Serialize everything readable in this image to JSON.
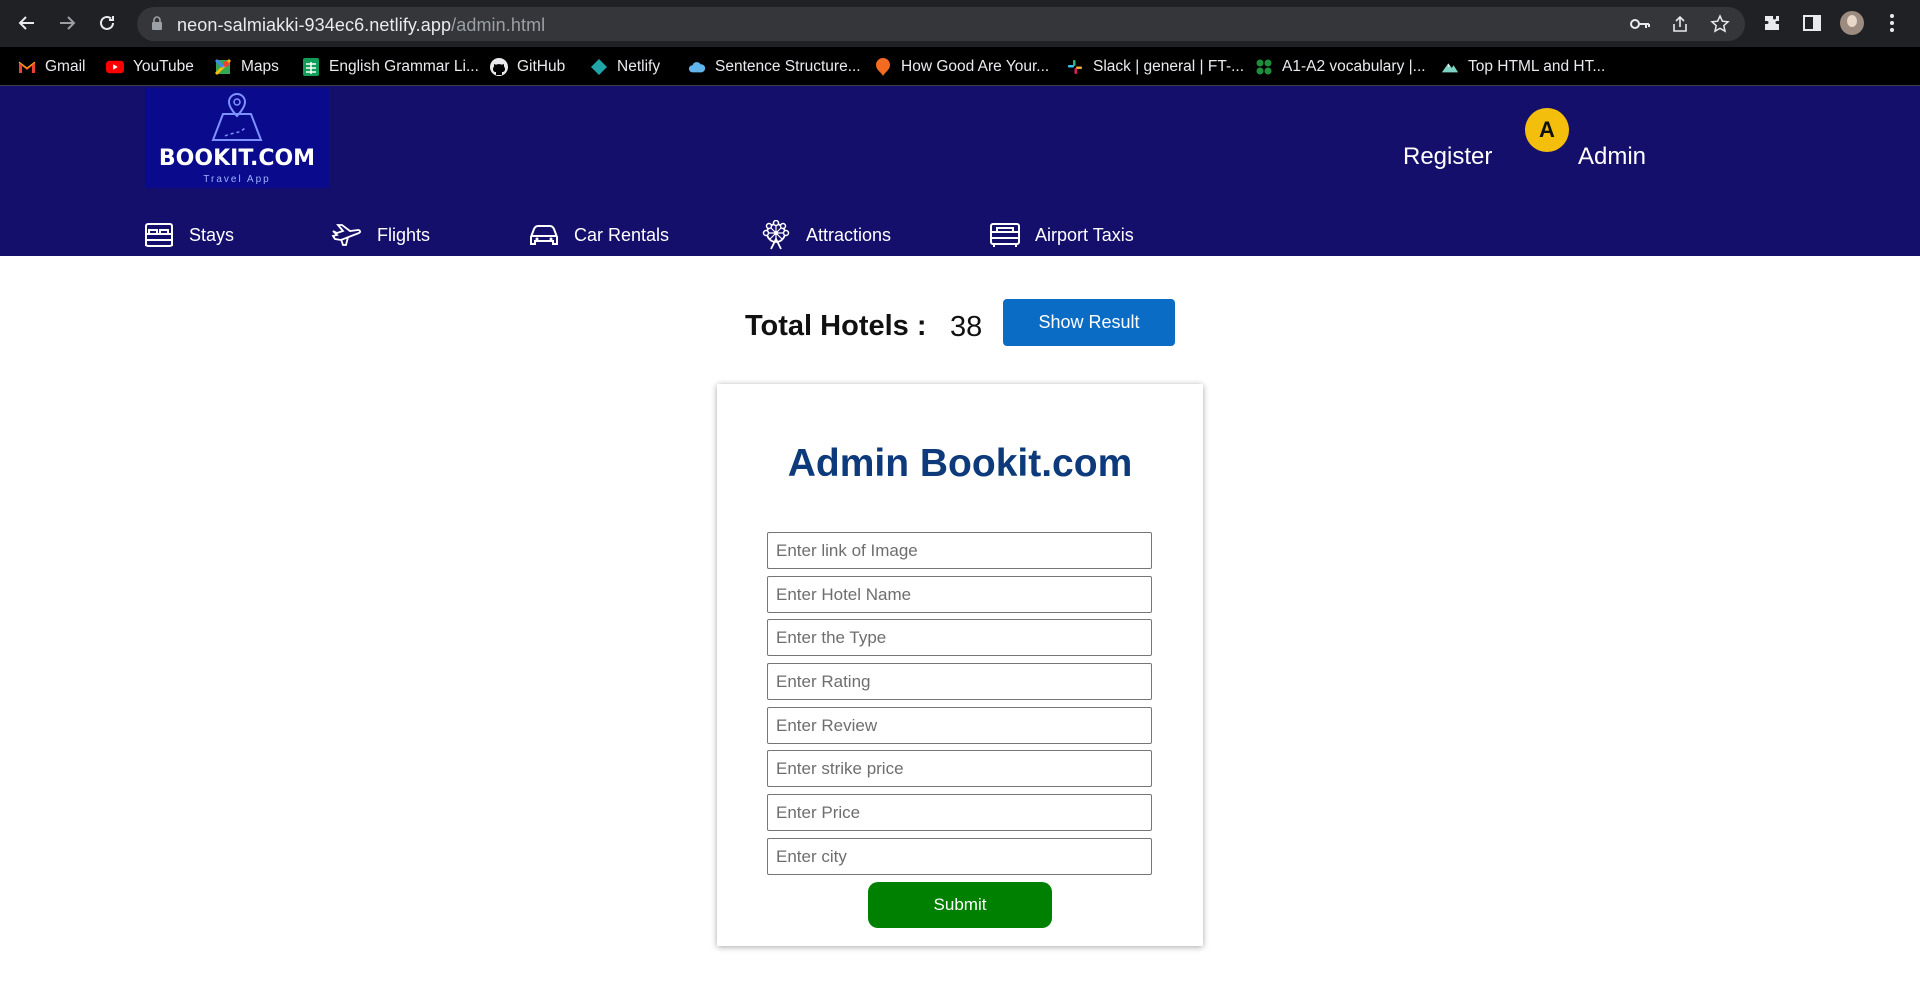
{
  "browser": {
    "url_host": "neon-salmiakki-934ec6.netlify.app",
    "url_path": "/admin.html",
    "bookmarks": [
      {
        "label": "Gmail",
        "icon": "gmail-icon"
      },
      {
        "label": "YouTube",
        "icon": "youtube-icon"
      },
      {
        "label": "Maps",
        "icon": "maps-icon"
      },
      {
        "label": "English Grammar Li...",
        "icon": "sheets-icon"
      },
      {
        "label": "GitHub",
        "icon": "github-icon"
      },
      {
        "label": "Netlify",
        "icon": "netlify-icon"
      },
      {
        "label": "Sentence Structure...",
        "icon": "cloud-icon"
      },
      {
        "label": "How Good Are Your...",
        "icon": "orange-bubble-icon"
      },
      {
        "label": "Slack | general | FT-...",
        "icon": "slack-icon"
      },
      {
        "label": "A1-A2 vocabulary |...",
        "icon": "green-dots-icon"
      },
      {
        "label": "Top HTML and HT...",
        "icon": "mountain-icon"
      }
    ]
  },
  "header": {
    "logo_title": "BOOKIT.COM",
    "logo_subtitle": "Travel App",
    "register": "Register",
    "avatar_letter": "A",
    "admin": "Admin",
    "nav": [
      {
        "label": "Stays",
        "icon": "bed-icon"
      },
      {
        "label": "Flights",
        "icon": "plane-icon"
      },
      {
        "label": "Car Rentals",
        "icon": "car-icon"
      },
      {
        "label": "Attractions",
        "icon": "ferris-wheel-icon"
      },
      {
        "label": "Airport Taxis",
        "icon": "taxi-icon"
      }
    ]
  },
  "summary": {
    "total_label": "Total Hotels :",
    "total_count": "38",
    "show_result": "Show Result"
  },
  "form": {
    "title": "Admin Bookit.com",
    "fields": [
      {
        "placeholder": "Enter link of Image"
      },
      {
        "placeholder": "Enter Hotel Name"
      },
      {
        "placeholder": "Enter the Type"
      },
      {
        "placeholder": "Enter Rating"
      },
      {
        "placeholder": "Enter Review"
      },
      {
        "placeholder": "Enter strike price"
      },
      {
        "placeholder": "Enter Price"
      },
      {
        "placeholder": "Enter city"
      }
    ],
    "submit": "Submit"
  },
  "colors": {
    "header_bg": "#140f6b",
    "avatar_bg": "#f4be0c",
    "show_result_bg": "#0a6cc4",
    "submit_bg": "#008000",
    "form_title": "#0d3a7a"
  }
}
